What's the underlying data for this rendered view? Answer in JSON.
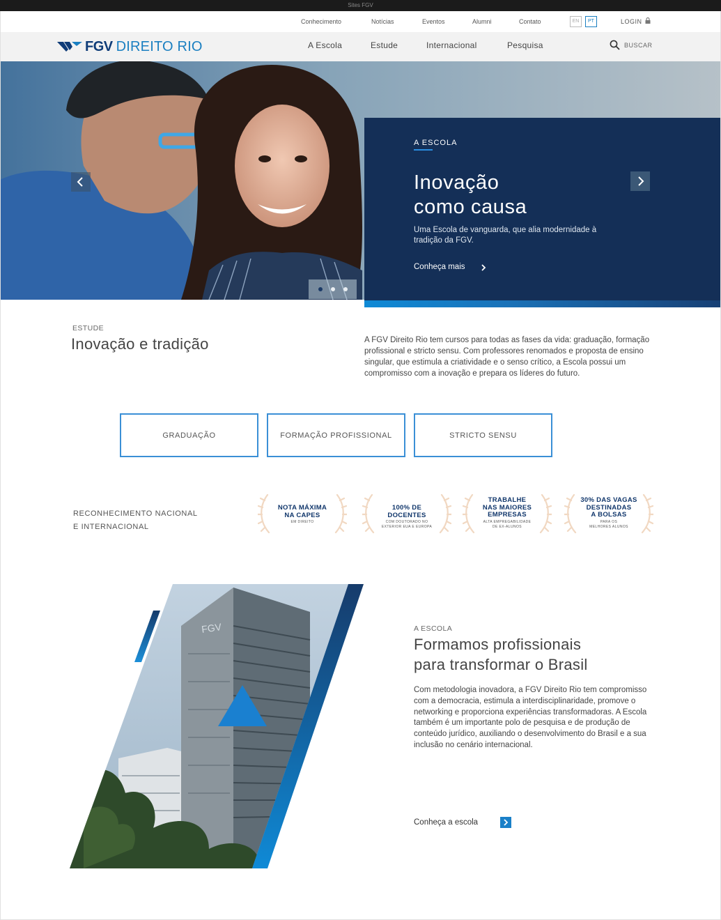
{
  "browser": {
    "strip_text": "Sites FGV"
  },
  "utility_nav": {
    "links": [
      "Conhecimento",
      "Notícias",
      "Eventos",
      "Alumni",
      "Contato"
    ],
    "lang_en": "EN",
    "lang_pt": "PT",
    "active_lang": "PT",
    "login": "LOGIN"
  },
  "header": {
    "logo_bold": "FGV",
    "logo_rest": "DIREITO RIO",
    "nav": [
      "A Escola",
      "Estude",
      "Internacional",
      "Pesquisa"
    ],
    "search_label": "BUSCAR"
  },
  "hero": {
    "kicker": "A ESCOLA",
    "title_line1": "Inovação",
    "title_line2": "como causa",
    "description": "Uma Escola de vanguarda, que alia modernidade à tradição da FGV.",
    "link": "Conheça mais",
    "slides_total": 3,
    "active_slide": 1
  },
  "estude": {
    "kicker": "ESTUDE",
    "title": "Inovação e tradição",
    "text": "A FGV Direito Rio tem cursos para todas as fases da vida: graduação, formação profissional e stricto sensu. Com professores renomados e proposta de ensino singular, que estimula a criatividade e o senso crítico, a Escola possui um compromisso com a inovação e prepara os líderes do futuro.",
    "buttons": [
      "GRADUAÇÃO",
      "FORMAÇÃO PROFISSIONAL",
      "STRICTO SENSU"
    ]
  },
  "recognition": {
    "label_line1": "RECONHECIMENTO NACIONAL",
    "label_line2": "E INTERNACIONAL",
    "badges": [
      {
        "title": [
          "NOTA MÁXIMA",
          "NA CAPES"
        ],
        "sub": [
          "EM DIREITO"
        ]
      },
      {
        "title": [
          "100% DE",
          "DOCENTES"
        ],
        "sub": [
          "COM DOUTORADO NO",
          "EXTERIOR EUA E EUROPA"
        ]
      },
      {
        "title": [
          "TRABALHE",
          "NAS MAIORES",
          "EMPRESAS"
        ],
        "sub": [
          "ALTA EMPREGABILIDADE",
          "DE EX-ALUNOS"
        ]
      },
      {
        "title": [
          "30% DAS VAGAS",
          "DESTINADAS",
          "A BOLSAS"
        ],
        "sub": [
          "PARA OS",
          "MELHORES ALUNOS"
        ]
      }
    ]
  },
  "escola": {
    "kicker": "A ESCOLA",
    "title_line1": "Formamos profissionais",
    "title_line2": "para transformar o Brasil",
    "text": "Com metodologia inovadora, a FGV Direito Rio tem compromisso com a democracia, estimula a interdisciplinaridade, promove o networking e proporciona experiências transformadoras. A Escola também é um importante polo de pesquisa e de produção de conteúdo jurídico, auxiliando o desenvolvimento do Brasil e a sua inclusão no cenário internacional.",
    "link": "Conheça a escola",
    "building_sign": "FGV"
  },
  "colors": {
    "navy": "#142f57",
    "brand_blue": "#1a7fc1",
    "accent_blue": "#3a8fd6",
    "logo_navy": "#0f3c78"
  }
}
